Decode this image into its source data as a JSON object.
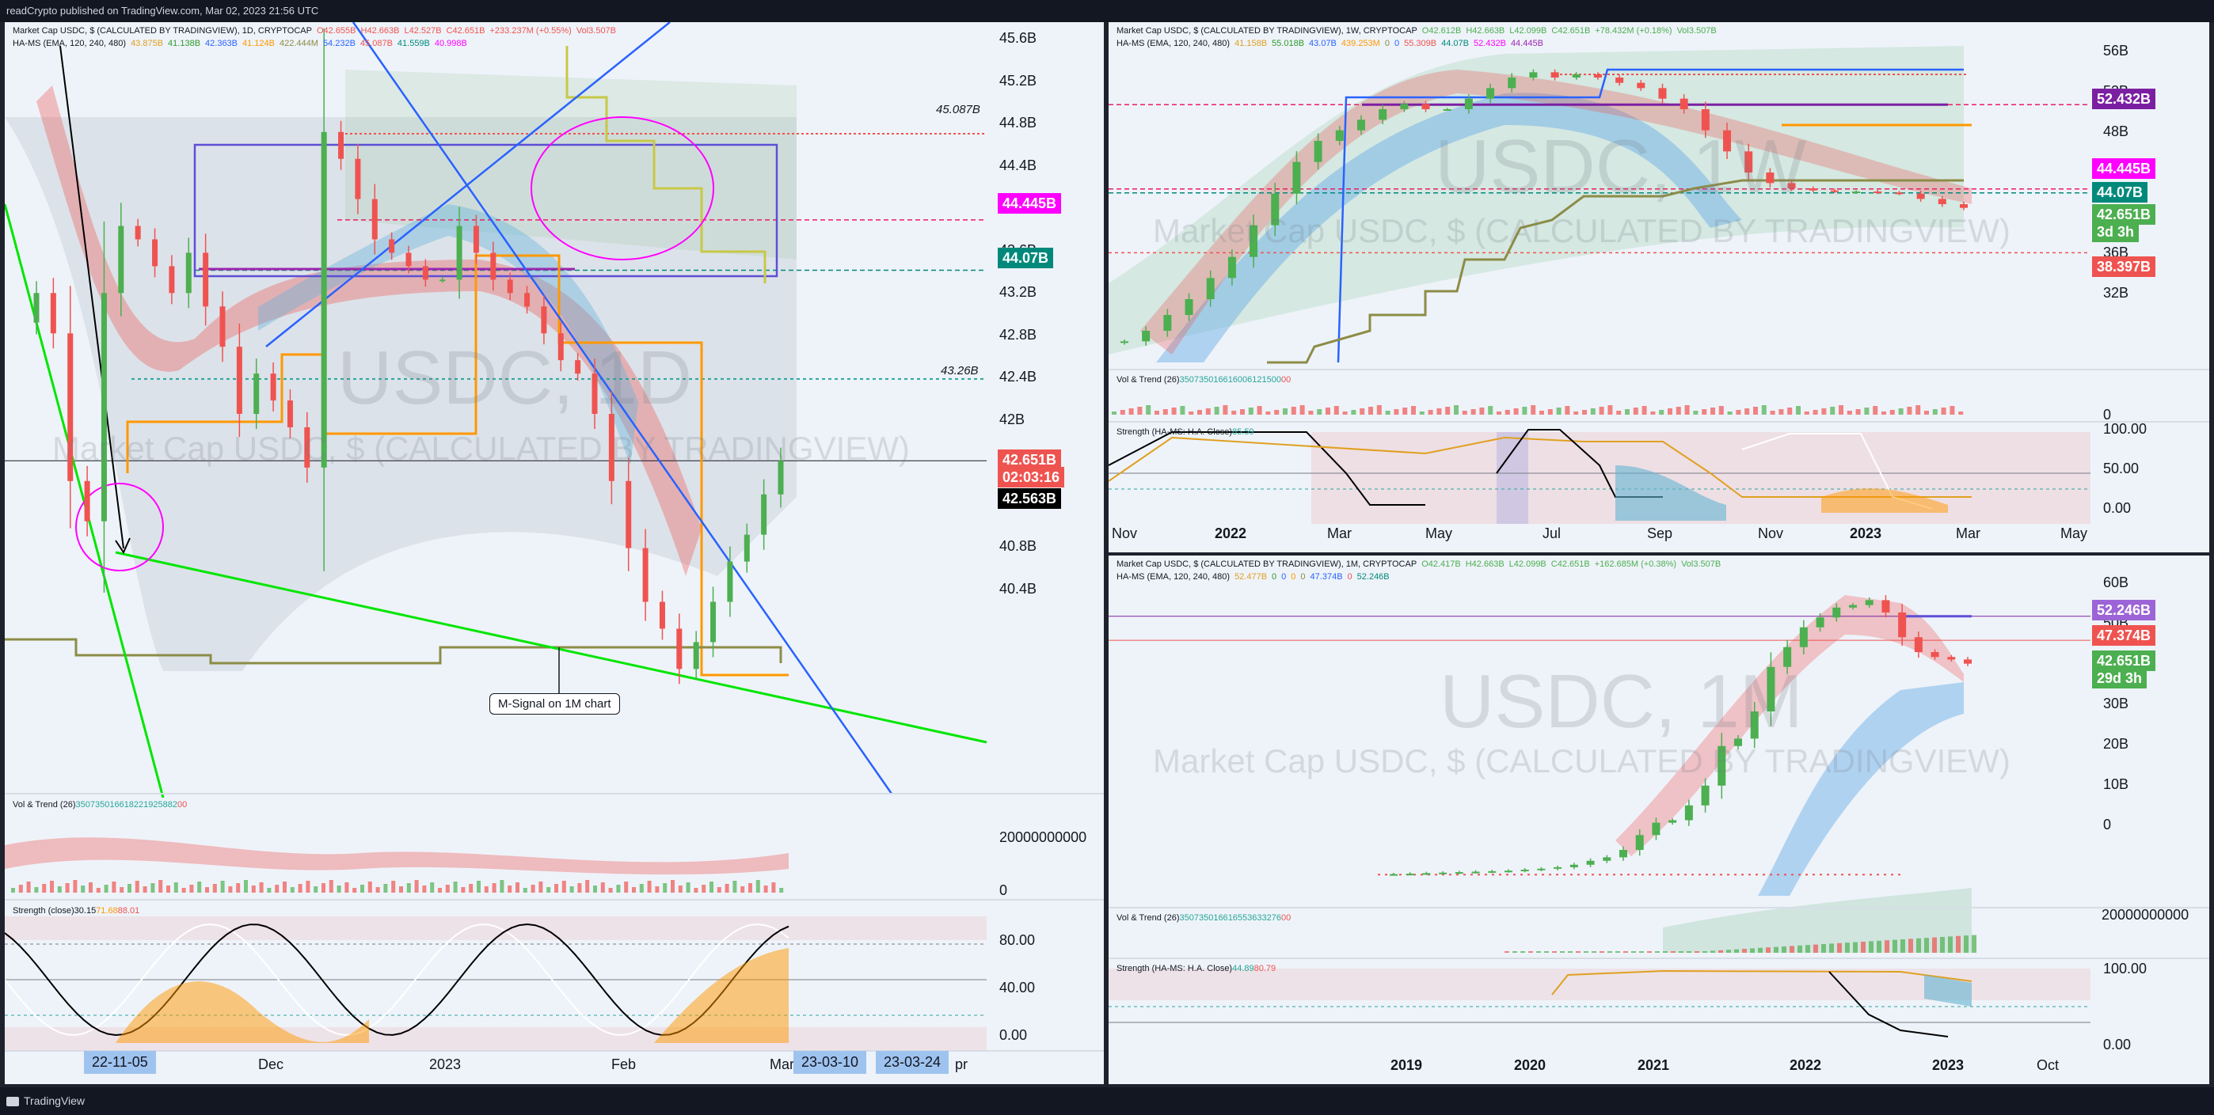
{
  "topbar": {
    "text": "readCrypto published on TradingView.com, Mar 02, 2023 21:56 UTC"
  },
  "bottombar": {
    "brand": "TradingView"
  },
  "colors": {
    "bg": "#eef3f9",
    "up": "#4caf50",
    "down": "#ef5350",
    "pink": "#e91e63",
    "magenta": "#ff00ff",
    "purple": "#7b1fa2",
    "blue": "#2962ff",
    "teal": "#00897b",
    "green_line": "#00e600",
    "olive": "#8c8c46",
    "orange": "#ff9800",
    "yellow": "#c8c846"
  },
  "panel_1d": {
    "header": {
      "line1": [
        "Market Cap USDC, $ (CALCULATED BY TRADINGVIEW), 1D, CRYPTOCAP",
        "O42.655B",
        "H42.663B",
        "L42.527B",
        "C42.651B",
        "+233.237M (+0.55%)",
        "Vol3.507B"
      ],
      "line2": [
        "HA-MS (EMA, 120, 240, 480)",
        "43.875B",
        "41.138B",
        "42.363B",
        "41.124B",
        "422.444M",
        "54.232B",
        "45.087B",
        "41.559B",
        "40.998B"
      ]
    },
    "watermark_big": "USDC, 1D",
    "watermark_small": "Market Cap USDC, $ (CALCULATED BY TRADINGVIEW)",
    "y_ticks": [
      "45.6B",
      "45.2B",
      "44.8B",
      "44.4B",
      "44.0B",
      "43.6B",
      "43.2B",
      "42.8B",
      "42.4B",
      "42B",
      "41.6B",
      "41.2B",
      "40.8B",
      "40.4B"
    ],
    "level_labels": {
      "upper": "45.087B",
      "lower": "43.26B"
    },
    "tags": {
      "pink": "44.445B",
      "teal": "44.07B",
      "price": "42.651B",
      "countdown": "02:03:16",
      "black": "42.563B"
    },
    "callout": "M-Signal on 1M chart",
    "vol_header": [
      "Vol & Trend (26)",
      "3507350166",
      "18221925882",
      "0",
      "0"
    ],
    "vol_ticks": [
      "20000000000",
      "0"
    ],
    "strength_header": [
      "Strength (close)",
      "30.15",
      "71.68",
      "88.01"
    ],
    "strength_ticks": [
      "80.00",
      "40.00",
      "0.00"
    ],
    "x_labels": [
      "Dec",
      "2023",
      "Feb",
      "Mar",
      "pr"
    ],
    "date_pills": [
      "22-11-05",
      "23-03-10",
      "23-03-24"
    ]
  },
  "panel_1w": {
    "header": {
      "line1": [
        "Market Cap USDC, $ (CALCULATED BY TRADINGVIEW), 1W, CRYPTOCAP",
        "O42.612B",
        "H42.663B",
        "L42.099B",
        "C42.651B",
        "+78.432M (+0.18%)",
        "Vol3.507B"
      ],
      "line2": [
        "HA-MS (EMA, 120, 240, 480)",
        "41.158B",
        "55.018B",
        "43.07B",
        "439.253M",
        "0",
        "0",
        "55.309B",
        "44.07B",
        "52.432B",
        "44.445B"
      ]
    },
    "watermark_big": "USDC, 1W",
    "watermark_small": "Market Cap USDC, $ (CALCULATED BY TRADINGVIEW)",
    "y_ticks": [
      "56B",
      "52B",
      "48B",
      "44B",
      "40B",
      "36B",
      "32B"
    ],
    "tags": {
      "purple": "52.432B",
      "pink": "44.445B",
      "teal": "44.07B",
      "price": "42.651B",
      "countdown": "3d 3h",
      "red": "38.397B"
    },
    "vol_header": [
      "Vol & Trend (26)",
      "3507350166",
      "16006121500",
      "0",
      "0"
    ],
    "vol_ticks": [
      "0"
    ],
    "strength_header": [
      "Strength (HA-MS: H.A. Close)",
      "85.59"
    ],
    "strength_ticks": [
      "100.00",
      "50.00",
      "0.00"
    ],
    "x_labels": [
      "Nov",
      "2022",
      "Mar",
      "May",
      "Jul",
      "Sep",
      "Nov",
      "2023",
      "Mar",
      "May"
    ]
  },
  "panel_1m": {
    "header": {
      "line1": [
        "Market Cap USDC, $ (CALCULATED BY TRADINGVIEW), 1M, CRYPTOCAP",
        "O42.417B",
        "H42.663B",
        "L42.099B",
        "C42.651B",
        "+162.685M (+0.38%)",
        "Vol3.507B"
      ],
      "line2": [
        "HA-MS (EMA, 120, 240, 480)",
        "52.477B",
        "0",
        "0",
        "0",
        "0",
        "47.374B",
        "0",
        "52.246B"
      ]
    },
    "watermark_big": "USDC, 1M",
    "watermark_small": "Market Cap USDC, $ (CALCULATED BY TRADINGVIEW)",
    "y_ticks": [
      "60B",
      "50B",
      "40B",
      "30B",
      "20B",
      "10B",
      "0"
    ],
    "tags": {
      "purple": "52.246B",
      "red": "47.374B",
      "price": "42.651B",
      "countdown": "29d 3h"
    },
    "vol_header": [
      "Vol & Trend (26)",
      "3507350166",
      "16553633276",
      "0",
      "0"
    ],
    "vol_ticks": [
      "20000000000"
    ],
    "strength_header": [
      "Strength (HA-MS: H.A. Close)",
      "44.89",
      "80.79"
    ],
    "strength_ticks": [
      "100.00",
      "0.00"
    ],
    "x_labels": [
      "2019",
      "2020",
      "2021",
      "2022",
      "2023",
      "Oct"
    ]
  },
  "chart_data": [
    {
      "type": "candlestick",
      "timeframe": "1D",
      "ylim": [
        40.2,
        45.8
      ],
      "y_unit": "B",
      "x": [
        "Nov",
        "Dec",
        "2023",
        "Feb",
        "Mar"
      ],
      "close_series": [
        43.9,
        43.6,
        42.5,
        42.2,
        43.9,
        44.4,
        44.3,
        44.1,
        43.9,
        44.2,
        43.8,
        43.5,
        43.0,
        43.3,
        43.1,
        42.9,
        42.6,
        45.1,
        44.9,
        44.6,
        44.3,
        44.2,
        44.1,
        44.0,
        44.0,
        44.4,
        44.2,
        44.0,
        43.9,
        43.8,
        43.6,
        43.4,
        43.3,
        43.0,
        42.5,
        42.0,
        41.6,
        41.4,
        41.1,
        41.3,
        41.6,
        41.9,
        42.1,
        42.4,
        42.651
      ],
      "levels": {
        "upper": 45.087,
        "pink": 44.445,
        "teal": 44.07,
        "lower": 43.26,
        "price": 42.651,
        "black": 42.563
      }
    },
    {
      "type": "candlestick",
      "timeframe": "1W",
      "ylim": [
        28,
        58
      ],
      "y_unit": "B",
      "x": [
        "Nov",
        "2022",
        "Mar",
        "May",
        "Jul",
        "Sep",
        "Nov",
        "2023",
        "Mar",
        "May"
      ],
      "close_series": [
        30,
        31,
        32.5,
        34,
        36,
        38,
        41,
        44,
        47,
        49,
        50,
        51,
        52,
        52.5,
        52,
        52,
        53,
        54,
        55,
        55.5,
        55,
        55.3,
        55,
        54.5,
        54,
        53,
        52,
        50,
        48,
        46,
        45,
        44.5,
        44.3,
        44.2,
        44.2,
        44.1,
        44,
        43.5,
        43,
        42.651
      ],
      "levels": {
        "purple": 52.432,
        "pink": 44.445,
        "teal": 44.07,
        "price": 42.651,
        "red": 38.397
      }
    },
    {
      "type": "candlestick",
      "timeframe": "1M",
      "ylim": [
        -3,
        61
      ],
      "y_unit": "B",
      "x": [
        "2019",
        "2020",
        "2021",
        "2022",
        "2023",
        "Oct"
      ],
      "close_series": [
        0.1,
        0.2,
        0.3,
        0.4,
        0.5,
        0.6,
        0.7,
        0.8,
        1.0,
        1.2,
        1.5,
        2.0,
        2.8,
        3.5,
        5.0,
        8.0,
        10.5,
        11.0,
        14.0,
        18.0,
        26.0,
        27.5,
        33.0,
        42.0,
        46.0,
        50.0,
        52.0,
        54.0,
        54.5,
        55.5,
        53.0,
        48.0,
        45.0,
        44.0,
        43.5,
        42.651
      ],
      "levels": {
        "purple": 52.246,
        "red": 47.374,
        "price": 42.651
      }
    }
  ]
}
